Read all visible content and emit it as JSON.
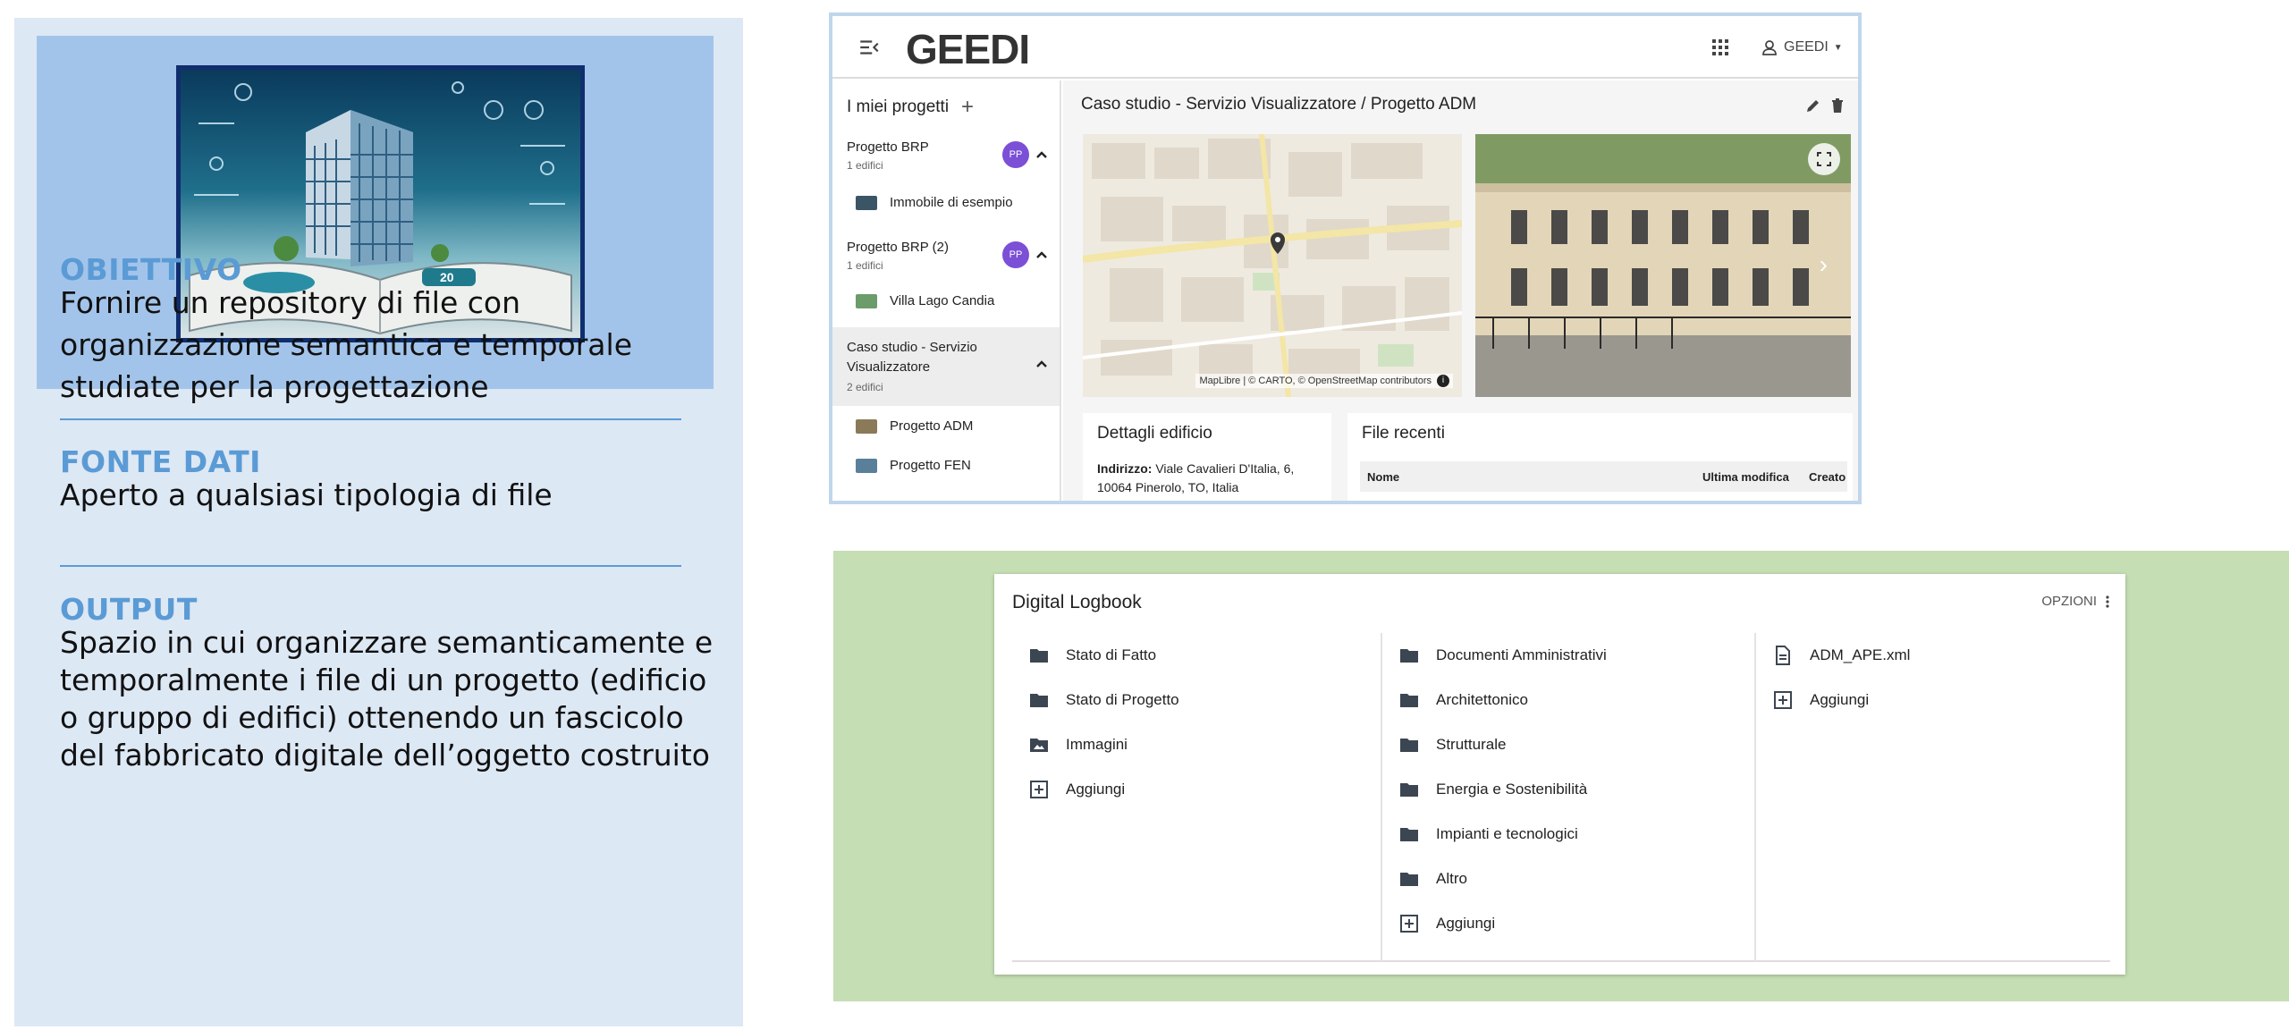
{
  "info": {
    "sections": [
      {
        "title": "OBIETTIVO",
        "text": "Fornire un repository di file con organizzazione semantica e temporale studiate per la progettazione"
      },
      {
        "title": "FONTE DATI",
        "text": "Aperto a qualsiasi tipologia di file"
      },
      {
        "title": "OUTPUT",
        "text": "Spazio in cui organizzare semanticamente e temporalmente i file di un progetto (edificio o gruppo di edifici) ottenendo un fascicolo del fabbricato digitale dell’oggetto costruito"
      }
    ],
    "hero_label": "20"
  },
  "app": {
    "logo": "GEEDI",
    "user_label": "GEEDI",
    "sidebar": {
      "title": "I miei progetti",
      "projects": [
        {
          "name": "Progetto BRP",
          "count": "1 edifici",
          "badge": "PP",
          "buildings": [
            "Immobile di esempio"
          ]
        },
        {
          "name": "Progetto BRP (2)",
          "count": "1 edifici",
          "badge": "PP",
          "buildings": [
            "Villa Lago Candia"
          ]
        },
        {
          "name": "Caso studio - Servizio Visualizzatore",
          "count": "2 edifici",
          "buildings": [
            "Progetto ADM",
            "Progetto FEN"
          ]
        }
      ]
    },
    "breadcrumb": {
      "parent": "Caso studio - Servizio Visualizzatore",
      "current": "Progetto ADM"
    },
    "map_attribution": "MapLibre | © CARTO, © OpenStreetMap contributors",
    "details": {
      "title": "Dettagli edificio",
      "address_label": "Indirizzo:",
      "address_value": "Viale Cavalieri D'Italia, 6, 10064 Pinerolo, TO, Italia"
    },
    "files": {
      "title": "File recenti",
      "columns": [
        "Nome",
        "Ultima modifica",
        "Creato"
      ]
    }
  },
  "logbook": {
    "title": "Digital Logbook",
    "options_label": "OPZIONI",
    "columns": [
      [
        {
          "label": "Stato di Fatto",
          "icon": "folder-icon"
        },
        {
          "label": "Stato di Progetto",
          "icon": "folder-icon"
        },
        {
          "label": "Immagini",
          "icon": "image-folder-icon"
        },
        {
          "label": "Aggiungi",
          "icon": "add-box-icon"
        }
      ],
      [
        {
          "label": "Documenti Amministrativi",
          "icon": "folder-icon"
        },
        {
          "label": "Architettonico",
          "icon": "folder-icon"
        },
        {
          "label": "Strutturale",
          "icon": "folder-icon"
        },
        {
          "label": "Energia e Sostenibilità",
          "icon": "folder-icon"
        },
        {
          "label": "Impianti e tecnologici",
          "icon": "folder-icon"
        },
        {
          "label": "Altro",
          "icon": "folder-icon"
        },
        {
          "label": "Aggiungi",
          "icon": "add-box-icon"
        }
      ],
      [
        {
          "label": "ADM_APE.xml",
          "icon": "file-icon"
        },
        {
          "label": "Aggiungi",
          "icon": "add-box-icon"
        }
      ]
    ]
  }
}
